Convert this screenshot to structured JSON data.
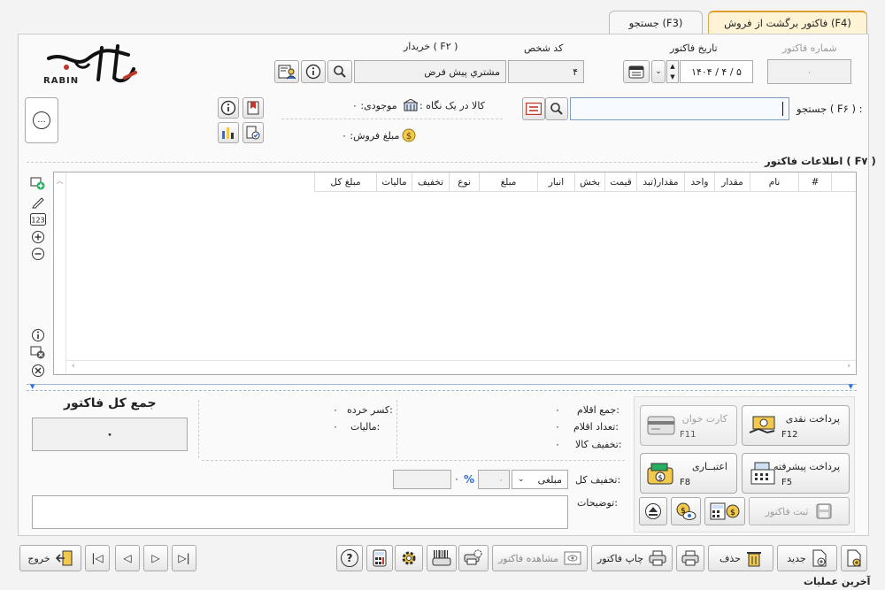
{
  "tabs": [
    {
      "label": "فاکتور برگشت از فروش (F4)",
      "active": true
    },
    {
      "label": "جستجو (F3)",
      "active": false
    }
  ],
  "logo": {
    "text": "RABIN"
  },
  "header": {
    "invoice_number_label": "شماره فاکتور",
    "invoice_number_value": "۰",
    "invoice_date_label": "تاریخ فاکتور",
    "invoice_date_value": "۱۴۰۴ / ۴ / ۵",
    "person_code_label": "کد شخص",
    "person_code_value": "۴",
    "buyer_label": "خریدار ( F۲ )",
    "buyer_value": "مشتري پيش فرض"
  },
  "search": {
    "label": "جستجو ( F۶ ) :",
    "value": ""
  },
  "quick_view": {
    "goods_label": ": کالا در یک نگاه",
    "stock_label": "موجودی: ۰",
    "sale_amount_label": "مبلغ فروش: ۰",
    "more_label": "..."
  },
  "table": {
    "title": "اطلاعات فاکتور ( F۷ )",
    "columns": [
      "#",
      "نام",
      "مقدار",
      "واحد",
      "مقدار(تبد",
      "قیمت",
      "بخش",
      "انبار",
      "مبلغ",
      "نوع",
      "تخفیف",
      "مالیات",
      "مبلغ کل"
    ]
  },
  "summary": {
    "items_sum_label": "جمع اقلام:",
    "items_sum_value": "۰",
    "items_count_label": "تعداد اقلام:",
    "items_count_value": "۰",
    "goods_discount_label": "تخفیف کالا:",
    "goods_discount_value": "۰",
    "fraction_label": "کسر خرده:",
    "fraction_value": "۰",
    "tax_label": "مالیات:",
    "tax_value": "۰",
    "total_title": "جمع کل فاکتور",
    "total_value": "۰",
    "total_discount_label": "تخفیف کل:",
    "discount_type": "مبلغی",
    "discount_amount": "۰",
    "discount_percent_symbol": "%",
    "discount_value": "۰",
    "notes_label": "توضیحات:",
    "notes_value": ""
  },
  "payment_buttons": {
    "cash": {
      "label": "پرداخت نقدی",
      "key": "F12"
    },
    "card": {
      "label": "کارت خوان",
      "key": "F11"
    },
    "advanced": {
      "label": "پرداخت پیشرفته",
      "key": "F5"
    },
    "credit": {
      "label": "اعتبــاری",
      "key": "F8"
    },
    "register": {
      "label": "ثبت فاکتور"
    }
  },
  "bottom_bar": {
    "new_label": "جدید",
    "delete_label": "حذف",
    "print_invoice_label": "چاپ فاکتور",
    "view_invoice_label": "مشاهده فاکتور",
    "exit_label": "خروج",
    "help_label": "?"
  },
  "status": {
    "last_operations_label": "آخرین عملیات"
  },
  "colors": {
    "accent": "#c0392b",
    "tab_active_bg": "#fff3d6",
    "blue": "#2a6fdb"
  }
}
